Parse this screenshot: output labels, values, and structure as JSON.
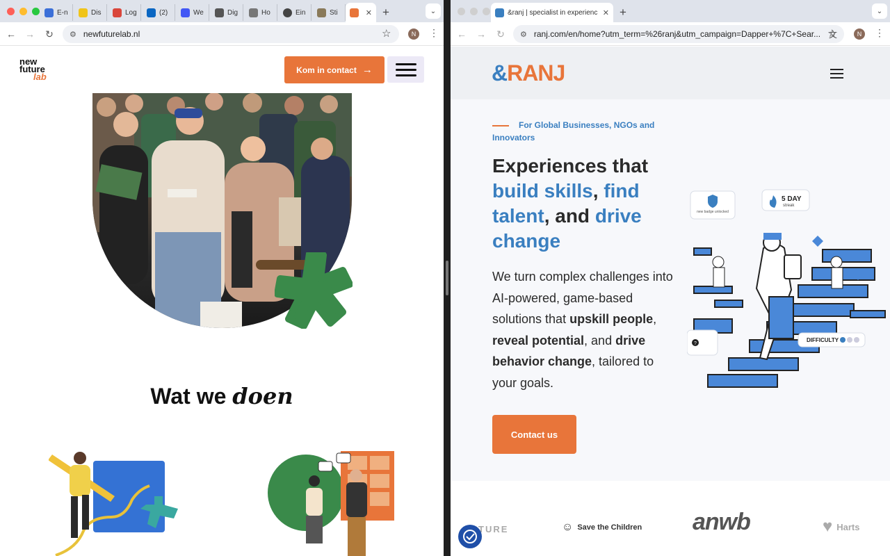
{
  "left_window": {
    "tabs": [
      {
        "label": "E-n",
        "icon": "ms-icon",
        "color": "#3b6fd8"
      },
      {
        "label": "Dis",
        "icon": "app-icon",
        "color": "#f0c419"
      },
      {
        "label": "Log",
        "icon": "log-icon",
        "color": "#d9463b"
      },
      {
        "label": "(2)",
        "icon": "linkedin-icon",
        "color": "#0a66c2"
      },
      {
        "label": "We",
        "icon": "slash-icon",
        "color": "#4257f5"
      },
      {
        "label": "Dig",
        "icon": "cross-icon",
        "color": "#555555"
      },
      {
        "label": "Ho",
        "icon": "ho-icon",
        "color": "#777777"
      },
      {
        "label": "Ein",
        "icon": "globe-icon",
        "color": "#444444"
      },
      {
        "label": "Sti",
        "icon": "shield-icon",
        "color": "#8a7a5a"
      }
    ],
    "active_tab_close": "✕",
    "new_tab": "+",
    "url": "newfuturelab.nl",
    "profile_initial": "N",
    "logo": {
      "line1": "new",
      "line2": "future",
      "line3": "lab"
    },
    "cta": "Kom in contact",
    "section_title": "Wat we",
    "section_title_em": "doen"
  },
  "right_window": {
    "tab_title": "&ranj | specialist in experienc",
    "tab_close": "✕",
    "new_tab": "+",
    "url": "ranj.com/en/home?utm_term=%26ranj&utm_campaign=Dapper+%7C+Sear...",
    "profile_initial": "N",
    "logo": {
      "amp": "&",
      "text": "RANJ"
    },
    "kicker": "For Global Businesses, NGOs and Innovators",
    "headline": {
      "part1": "Experiences that ",
      "blue1": "build skills",
      "part2": ", ",
      "blue2": "find talent",
      "part3": ", and ",
      "blue3": "drive change"
    },
    "lead": {
      "t1": "We turn complex challenges into AI-powered, game-based solutions that ",
      "b1": "upskill people",
      "t2": ", ",
      "b2": "reveal potential",
      "t3": ", and ",
      "b3": "drive behavior change",
      "t4": ", tailored to your goals."
    },
    "contact": "Contact us",
    "hero_labels": {
      "badge": "new badge unlocked",
      "streak_big": "5 DAY",
      "streak_small": "streak",
      "difficulty": "DIFFICULTY",
      "question": "?"
    },
    "partners": {
      "p1": "TURE",
      "p2": "Save the Children",
      "p3": "anwb",
      "p4": "Harts"
    }
  },
  "colors": {
    "orange": "#e8753a",
    "ranj_blue": "#3a7fc0",
    "green": "#3a8a4a"
  }
}
